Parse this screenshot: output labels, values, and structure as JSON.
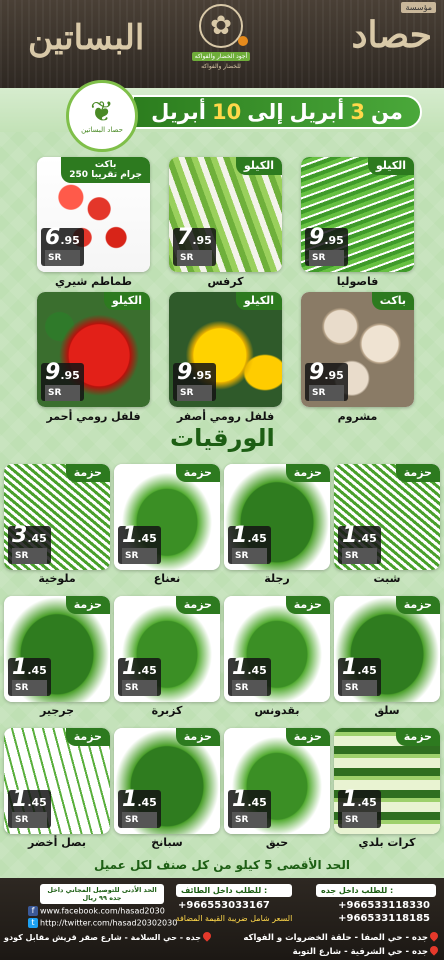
{
  "header": {
    "est_label": "مؤسسة",
    "brand_right": "حصاد",
    "brand_left": "البساتين",
    "logo_tag": "أجود الخضار والفواكه",
    "logo_tag2": "للخضار والفواكه"
  },
  "offer": {
    "circle_logo_text": "حصاد البساتين",
    "from_word": "من",
    "from_day": "3",
    "from_month": "أبريل",
    "to_word": "إلى",
    "to_day": "10",
    "to_month": "أبريل"
  },
  "top_products": [
    {
      "name": "طماطم شيري",
      "unit": "باكت",
      "unit_extra": "250 جرام تقريبا",
      "price_int": "6",
      "price_dec": ".95",
      "currency": "SR"
    },
    {
      "name": "كرفس",
      "unit": "الكيلو",
      "unit_extra": "",
      "price_int": "7",
      "price_dec": ".95",
      "currency": "SR"
    },
    {
      "name": "فاصوليا",
      "unit": "الكيلو",
      "unit_extra": "",
      "price_int": "9",
      "price_dec": ".95",
      "currency": "SR"
    },
    {
      "name": "فلفل رومي أحمر",
      "unit": "الكيلو",
      "unit_extra": "",
      "price_int": "9",
      "price_dec": ".95",
      "currency": "SR"
    },
    {
      "name": "فلفل رومي أصفر",
      "unit": "الكيلو",
      "unit_extra": "",
      "price_int": "9",
      "price_dec": ".95",
      "currency": "SR"
    },
    {
      "name": "مشروم",
      "unit": "باكت",
      "unit_extra": "",
      "price_int": "9",
      "price_dec": ".95",
      "currency": "SR"
    }
  ],
  "leafy_section_title": "الورقيات",
  "leafy_products": [
    {
      "name": "ملوخية",
      "unit": "حزمة",
      "price_int": "3",
      "price_dec": ".45",
      "currency": "SR"
    },
    {
      "name": "نعناع",
      "unit": "حزمة",
      "price_int": "1",
      "price_dec": ".45",
      "currency": "SR"
    },
    {
      "name": "رجلة",
      "unit": "حزمة",
      "price_int": "1",
      "price_dec": ".45",
      "currency": "SR"
    },
    {
      "name": "شبت",
      "unit": "حزمة",
      "price_int": "1",
      "price_dec": ".45",
      "currency": "SR"
    },
    {
      "name": "جرجير",
      "unit": "حزمة",
      "price_int": "1",
      "price_dec": ".45",
      "currency": "SR"
    },
    {
      "name": "كزبرة",
      "unit": "حزمة",
      "price_int": "1",
      "price_dec": ".45",
      "currency": "SR"
    },
    {
      "name": "بقدونس",
      "unit": "حزمة",
      "price_int": "1",
      "price_dec": ".45",
      "currency": "SR"
    },
    {
      "name": "سلق",
      "unit": "حزمة",
      "price_int": "1",
      "price_dec": ".45",
      "currency": "SR"
    },
    {
      "name": "بصل أخضر",
      "unit": "حزمة",
      "price_int": "1",
      "price_dec": ".45",
      "currency": "SR"
    },
    {
      "name": "سبانخ",
      "unit": "حزمة",
      "price_int": "1",
      "price_dec": ".45",
      "currency": "SR"
    },
    {
      "name": "حبق",
      "unit": "حزمة",
      "price_int": "1",
      "price_dec": ".45",
      "currency": "SR"
    },
    {
      "name": "كرات بلدي",
      "unit": "حزمة",
      "price_int": "1",
      "price_dec": ".45",
      "currency": "SR"
    }
  ],
  "limit_note": "الحد الأقصى 5 كيلو من كل صنف لكل عميل",
  "footer": {
    "jeddah_label": "للطلب داخل جده :",
    "jeddah_phone1": "+966533118330",
    "jeddah_phone2": "+966533118185",
    "taif_label": "للطلب داخل الطائف :",
    "taif_phone": "+966553033167",
    "vat_note": "السعر شامل ضريبة القيمة المضافة",
    "min_order": "الحد الأدنى للتوصيل المجاني داخل جده ٩٩ ريال",
    "facebook": "www.facebook.com/hasad2030",
    "twitter": "http://twitter.com/hasad20302030",
    "address1": "جده - حي الصفا - حلقة الخضروات و الفواكه",
    "address2": "جده - حي السلامة - شارع صقر قريش مقابل كودو",
    "address3": "جده - حي الشرفية - شارع التوبة"
  },
  "colors": {
    "brand_green": "#2d7a1f",
    "date_num": "#ffd84a",
    "header_bg": "#2e2822"
  }
}
